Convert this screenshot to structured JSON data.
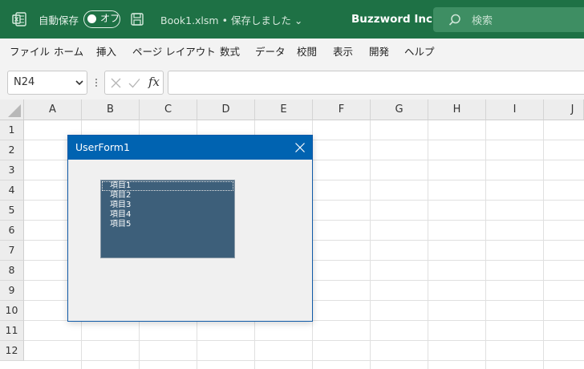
{
  "titlebar": {
    "autosave_label": "自動保存",
    "toggle_label": "オフ",
    "doc_title": "Book1.xlsm • 保存しました ⌄",
    "company": "Buzzword Inc.",
    "search_placeholder": "検索",
    "bg_color": "#1e7145"
  },
  "menu": {
    "items": [
      "ファイル",
      "ホーム",
      "挿入",
      "ページ レイアウト",
      "数式",
      "データ",
      "校閲",
      "表示",
      "開発",
      "ヘルプ"
    ]
  },
  "formula_bar": {
    "name_box": "N24",
    "fx_label": "fx",
    "formula": ""
  },
  "sheet": {
    "columns": [
      "A",
      "B",
      "C",
      "D",
      "E",
      "F",
      "G",
      "H",
      "I",
      "J"
    ],
    "rows": [
      "1",
      "2",
      "3",
      "4",
      "5",
      "6",
      "7",
      "8",
      "9",
      "10",
      "11",
      "12"
    ]
  },
  "userform": {
    "title": "UserForm1",
    "listbox": {
      "items": [
        "項目1",
        "項目2",
        "項目3",
        "項目4",
        "項目5"
      ],
      "selected_index": 0
    },
    "title_color": "#0063b1"
  }
}
